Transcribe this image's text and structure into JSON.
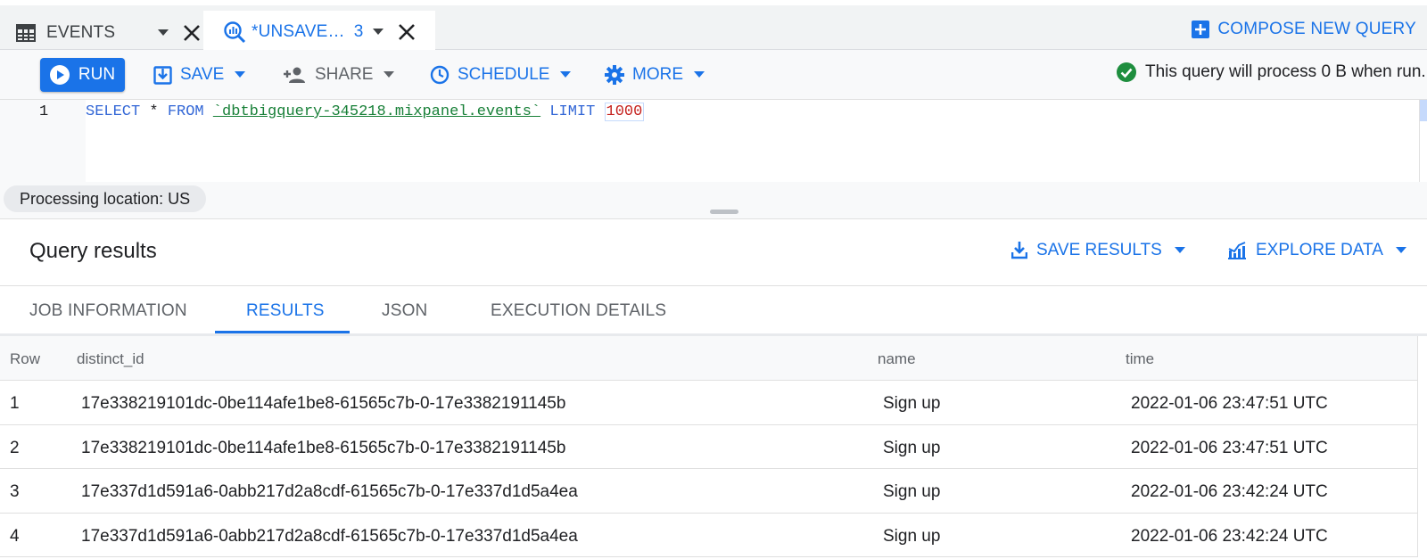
{
  "tabs": {
    "events": {
      "label": "EVENTS"
    },
    "active": {
      "label": "*UNSAVE…",
      "count": "3"
    },
    "compose_label": "COMPOSE NEW QUERY"
  },
  "toolbar": {
    "run_label": "RUN",
    "save_label": "SAVE",
    "share_label": "SHARE",
    "schedule_label": "SCHEDULE",
    "more_label": "MORE",
    "status_text": "This query will process 0 B when run."
  },
  "editor": {
    "line_number": "1",
    "kw_select": "SELECT",
    "star": " * ",
    "kw_from": "FROM",
    "table_ref": "`dbtbigquery-345218.mixpanel.events`",
    "kw_limit": "LIMIT",
    "limit_value": "1000"
  },
  "processing": {
    "location_label": "Processing location: US"
  },
  "results": {
    "title": "Query results",
    "save_results_label": "SAVE RESULTS",
    "explore_data_label": "EXPLORE DATA",
    "tabs": [
      {
        "label": "JOB INFORMATION"
      },
      {
        "label": "RESULTS"
      },
      {
        "label": "JSON"
      },
      {
        "label": "EXECUTION DETAILS"
      }
    ],
    "columns": [
      "Row",
      "distinct_id",
      "name",
      "time"
    ],
    "rows": [
      {
        "row": "1",
        "distinct_id": "17e338219101dc-0be114afe1be8-61565c7b-0-17e3382191145b",
        "name": "Sign up",
        "time": "2022-01-06 23:47:51 UTC"
      },
      {
        "row": "2",
        "distinct_id": "17e338219101dc-0be114afe1be8-61565c7b-0-17e3382191145b",
        "name": "Sign up",
        "time": "2022-01-06 23:47:51 UTC"
      },
      {
        "row": "3",
        "distinct_id": "17e337d1d591a6-0abb217d2a8cdf-61565c7b-0-17e337d1d5a4ea",
        "name": "Sign up",
        "time": "2022-01-06 23:42:24 UTC"
      },
      {
        "row": "4",
        "distinct_id": "17e337d1d591a6-0abb217d2a8cdf-61565c7b-0-17e337d1d5a4ea",
        "name": "Sign up",
        "time": "2022-01-06 23:42:24 UTC"
      }
    ]
  },
  "colors": {
    "accent": "#1a73e8",
    "success": "#1e8e3e",
    "string": "#188038",
    "number": "#c5221f"
  }
}
